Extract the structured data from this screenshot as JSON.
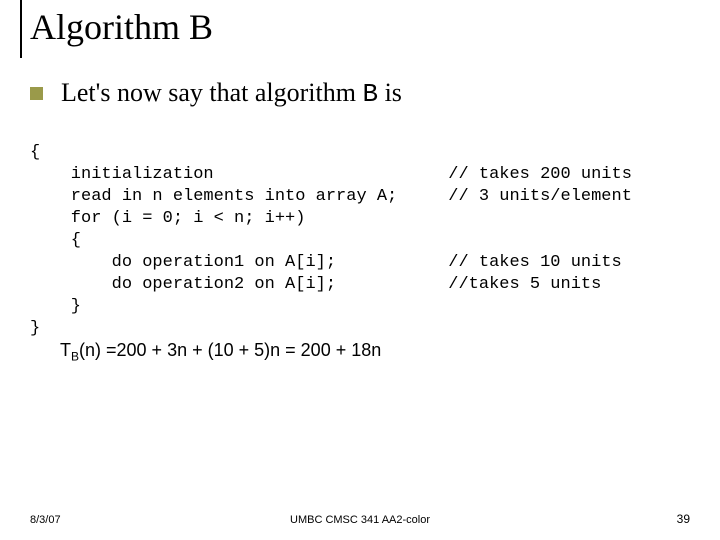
{
  "title": "Algorithm B",
  "lead_prefix": "Let's now say that algorithm ",
  "lead_code": "B",
  "lead_suffix": " is",
  "code_lines": [
    "{",
    "    initialization                       // takes 200 units",
    "    read in n elements into array A;     // 3 units/element",
    "    for (i = 0; i < n; i++)",
    "    {",
    "        do operation1 on A[i];           // takes 10 units",
    "        do operation2 on A[i];           //takes 5 units",
    "    }",
    "}"
  ],
  "formula_prefix": "T",
  "formula_sub": "B",
  "formula_rest": "(n) =200 + 3n + (10 + 5)n = 200 + 18n",
  "footer": {
    "date": "8/3/07",
    "center": "UMBC CMSC 341 AA2-color",
    "page": "39"
  }
}
